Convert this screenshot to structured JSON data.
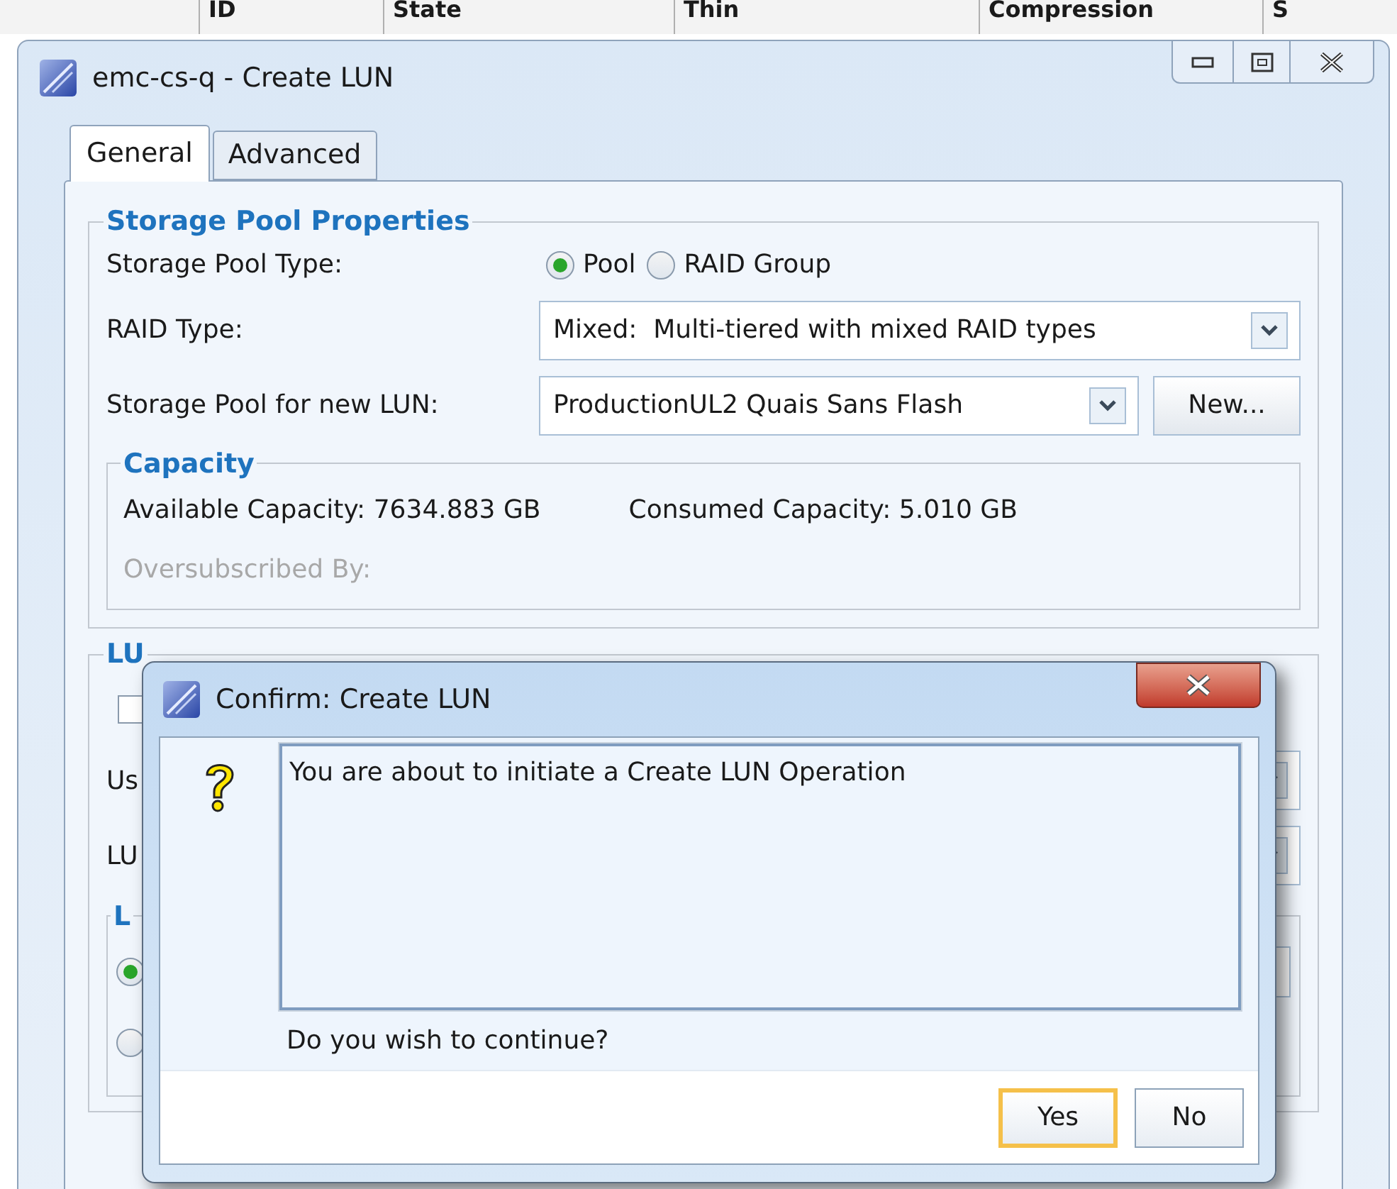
{
  "background_table": {
    "columns": [
      "ID",
      "State",
      "Thin",
      "Compression",
      "S"
    ]
  },
  "window": {
    "title": "emc-cs-q - Create LUN"
  },
  "tabs": [
    {
      "label": "General",
      "selected": true
    },
    {
      "label": "Advanced",
      "selected": false
    }
  ],
  "storage_pool_properties": {
    "title": "Storage Pool Properties",
    "pool_type": {
      "label": "Storage Pool Type:",
      "options": [
        {
          "label": "Pool",
          "selected": true
        },
        {
          "label": "RAID Group",
          "selected": false
        }
      ]
    },
    "raid_type": {
      "label": "RAID Type:",
      "value": "Mixed:  Multi-tiered with mixed RAID types"
    },
    "pool": {
      "label": "Storage Pool for new LUN:",
      "value": "ProductionUL2 Quais Sans Flash",
      "button": "New..."
    },
    "capacity": {
      "title": "Capacity",
      "available": "Available Capacity: 7634.883 GB",
      "consumed": "Consumed Capacity: 5.010 GB",
      "oversubscribed": {
        "label": "Oversubscribed By:",
        "disabled": true
      }
    }
  },
  "lun_properties": {
    "title": "LU",
    "checkbox": {
      "checked": false
    },
    "rows": [
      {
        "label": "Us"
      },
      {
        "label": "LU"
      }
    ],
    "group": {
      "title": "L",
      "options": [
        {
          "selected": true
        },
        {
          "selected": false
        }
      ]
    }
  },
  "dialog": {
    "title": "Confirm: Create LUN",
    "message": "You are about to initiate a Create LUN Operation",
    "question": "Do you wish to continue?",
    "buttons": [
      {
        "label": "Yes",
        "default": true
      },
      {
        "label": "No",
        "default": false
      }
    ]
  }
}
